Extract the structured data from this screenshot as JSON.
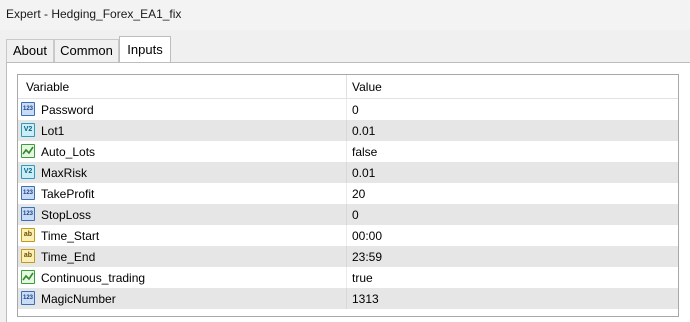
{
  "window": {
    "title": "Expert - Hedging_Forex_EA1_fix"
  },
  "tabs": [
    {
      "label": "About",
      "active": false
    },
    {
      "label": "Common",
      "active": false
    },
    {
      "label": "Inputs",
      "active": true
    }
  ],
  "table": {
    "columns": [
      "Variable",
      "Value"
    ],
    "rows": [
      {
        "icon": "integer-type-icon",
        "icon_text": "123",
        "variable": "Password",
        "value": "0"
      },
      {
        "icon": "double-type-icon",
        "icon_text": "V2",
        "variable": "Lot1",
        "value": "0.01"
      },
      {
        "icon": "boolean-type-icon",
        "icon_text": "",
        "variable": "Auto_Lots",
        "value": "false"
      },
      {
        "icon": "double-type-icon",
        "icon_text": "V2",
        "variable": "MaxRisk",
        "value": "0.01"
      },
      {
        "icon": "integer-type-icon",
        "icon_text": "123",
        "variable": "TakeProfit",
        "value": "20"
      },
      {
        "icon": "integer-type-icon",
        "icon_text": "123",
        "variable": "StopLoss",
        "value": "0"
      },
      {
        "icon": "string-type-icon",
        "icon_text": "ab",
        "variable": "Time_Start",
        "value": "00:00"
      },
      {
        "icon": "string-type-icon",
        "icon_text": "ab",
        "variable": "Time_End",
        "value": "23:59"
      },
      {
        "icon": "boolean-type-icon",
        "icon_text": "",
        "variable": "Continuous_trading",
        "value": "true"
      },
      {
        "icon": "integer-type-icon",
        "icon_text": "123",
        "variable": "MagicNumber",
        "value": "1313"
      }
    ]
  }
}
